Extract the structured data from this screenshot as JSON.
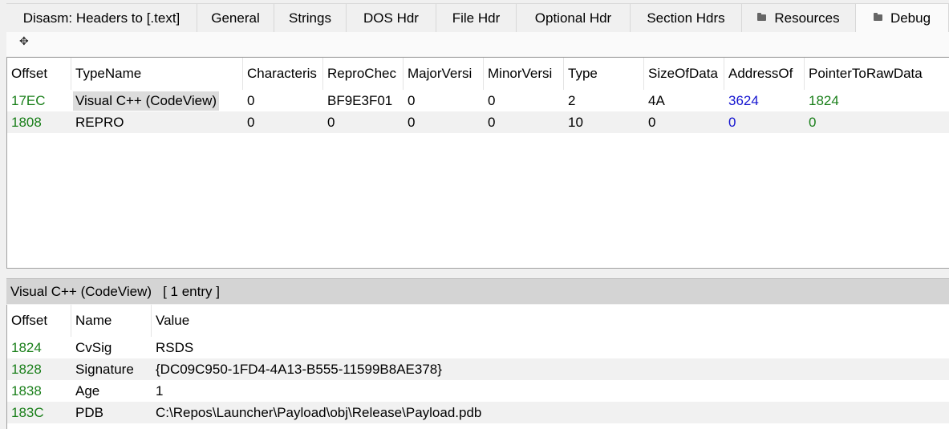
{
  "tabs": [
    {
      "label": "Disasm: Headers to [.text]",
      "folder": false,
      "active": false
    },
    {
      "label": "General",
      "folder": false,
      "active": false
    },
    {
      "label": "Strings",
      "folder": false,
      "active": false
    },
    {
      "label": "DOS Hdr",
      "folder": false,
      "active": false
    },
    {
      "label": "File Hdr",
      "folder": false,
      "active": false
    },
    {
      "label": "Optional Hdr",
      "folder": false,
      "active": false
    },
    {
      "label": "Section Hdrs",
      "folder": false,
      "active": false
    },
    {
      "label": "Resources",
      "folder": true,
      "active": false
    },
    {
      "label": "Debug",
      "folder": true,
      "active": true
    }
  ],
  "toolbar": {
    "move_icon": "move-icon"
  },
  "debug_table": {
    "columns": [
      "Offset",
      "TypeName",
      "Characteris",
      "ReproChec",
      "MajorVersi",
      "MinorVersi",
      "Type",
      "SizeOfData",
      "AddressOf",
      "PointerToRawData"
    ],
    "rows": [
      [
        "17EC",
        "Visual C++ (CodeView)",
        "0",
        "BF9E3F01",
        "0",
        "0",
        "2",
        "4A",
        "3624",
        "1824"
      ],
      [
        "1808",
        "REPRO",
        "0",
        "0",
        "0",
        "0",
        "10",
        "0",
        "0",
        "0"
      ]
    ]
  },
  "detail": {
    "title": "Visual C++ (CodeView)",
    "count": "[ 1 entry ]",
    "columns": [
      "Offset",
      "Name",
      "Value"
    ],
    "rows": [
      [
        "1824",
        "CvSig",
        "RSDS"
      ],
      [
        "1828",
        "Signature",
        "{DC09C950-1FD4-4A13-B555-11599B8AE378}"
      ],
      [
        "1838",
        "Age",
        "1"
      ],
      [
        "183C",
        "PDB",
        "C:\\Repos\\Launcher\\Payload\\obj\\Release\\Payload.pdb"
      ]
    ]
  },
  "colors": {
    "offset": "#1a7f1a",
    "address": "#1515d0",
    "selection": "#dcdcdc"
  }
}
